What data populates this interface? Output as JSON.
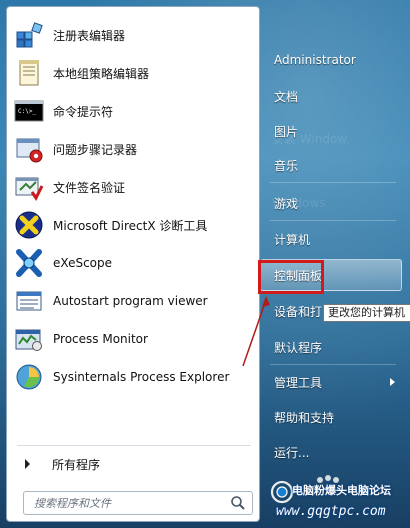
{
  "left_pane": {
    "programs": [
      {
        "label": "注册表编辑器",
        "icon": "registry-editor-icon"
      },
      {
        "label": "本地组策略编辑器",
        "icon": "group-policy-icon"
      },
      {
        "label": "命令提示符",
        "icon": "command-prompt-icon"
      },
      {
        "label": "问题步骤记录器",
        "icon": "problem-steps-recorder-icon"
      },
      {
        "label": "文件签名验证",
        "icon": "file-signature-icon"
      },
      {
        "label": "Microsoft DirectX 诊断工具",
        "icon": "directx-icon"
      },
      {
        "label": "eXeScope",
        "icon": "exescope-icon"
      },
      {
        "label": "Autostart program viewer",
        "icon": "autostart-viewer-icon"
      },
      {
        "label": "Process Monitor",
        "icon": "process-monitor-icon"
      },
      {
        "label": "Sysinternals Process Explorer",
        "icon": "process-explorer-icon"
      }
    ],
    "all_programs": "所有程序",
    "search_placeholder": "搜索程序和文件"
  },
  "right_pane": {
    "items": [
      {
        "label": "Administrator"
      },
      {
        "label": "文档"
      },
      {
        "label": "图片"
      },
      {
        "label": "音乐"
      },
      {
        "label": "游戏"
      },
      {
        "label": "计算机"
      },
      {
        "label": "控制面板"
      },
      {
        "label": "设备和打"
      },
      {
        "label": "默认程序"
      },
      {
        "label": "管理工具"
      },
      {
        "label": "帮助和支持"
      },
      {
        "label": "运行..."
      }
    ],
    "tooltip": "更改您的计算机",
    "highlighted": "控制面板"
  },
  "watermark": {
    "title": "电脑粉爆头电脑论坛",
    "url": "www.gqgtpc.com"
  },
  "colors": {
    "highlight_box": "#d11a1a",
    "menu_blue": "#2d78a8"
  }
}
